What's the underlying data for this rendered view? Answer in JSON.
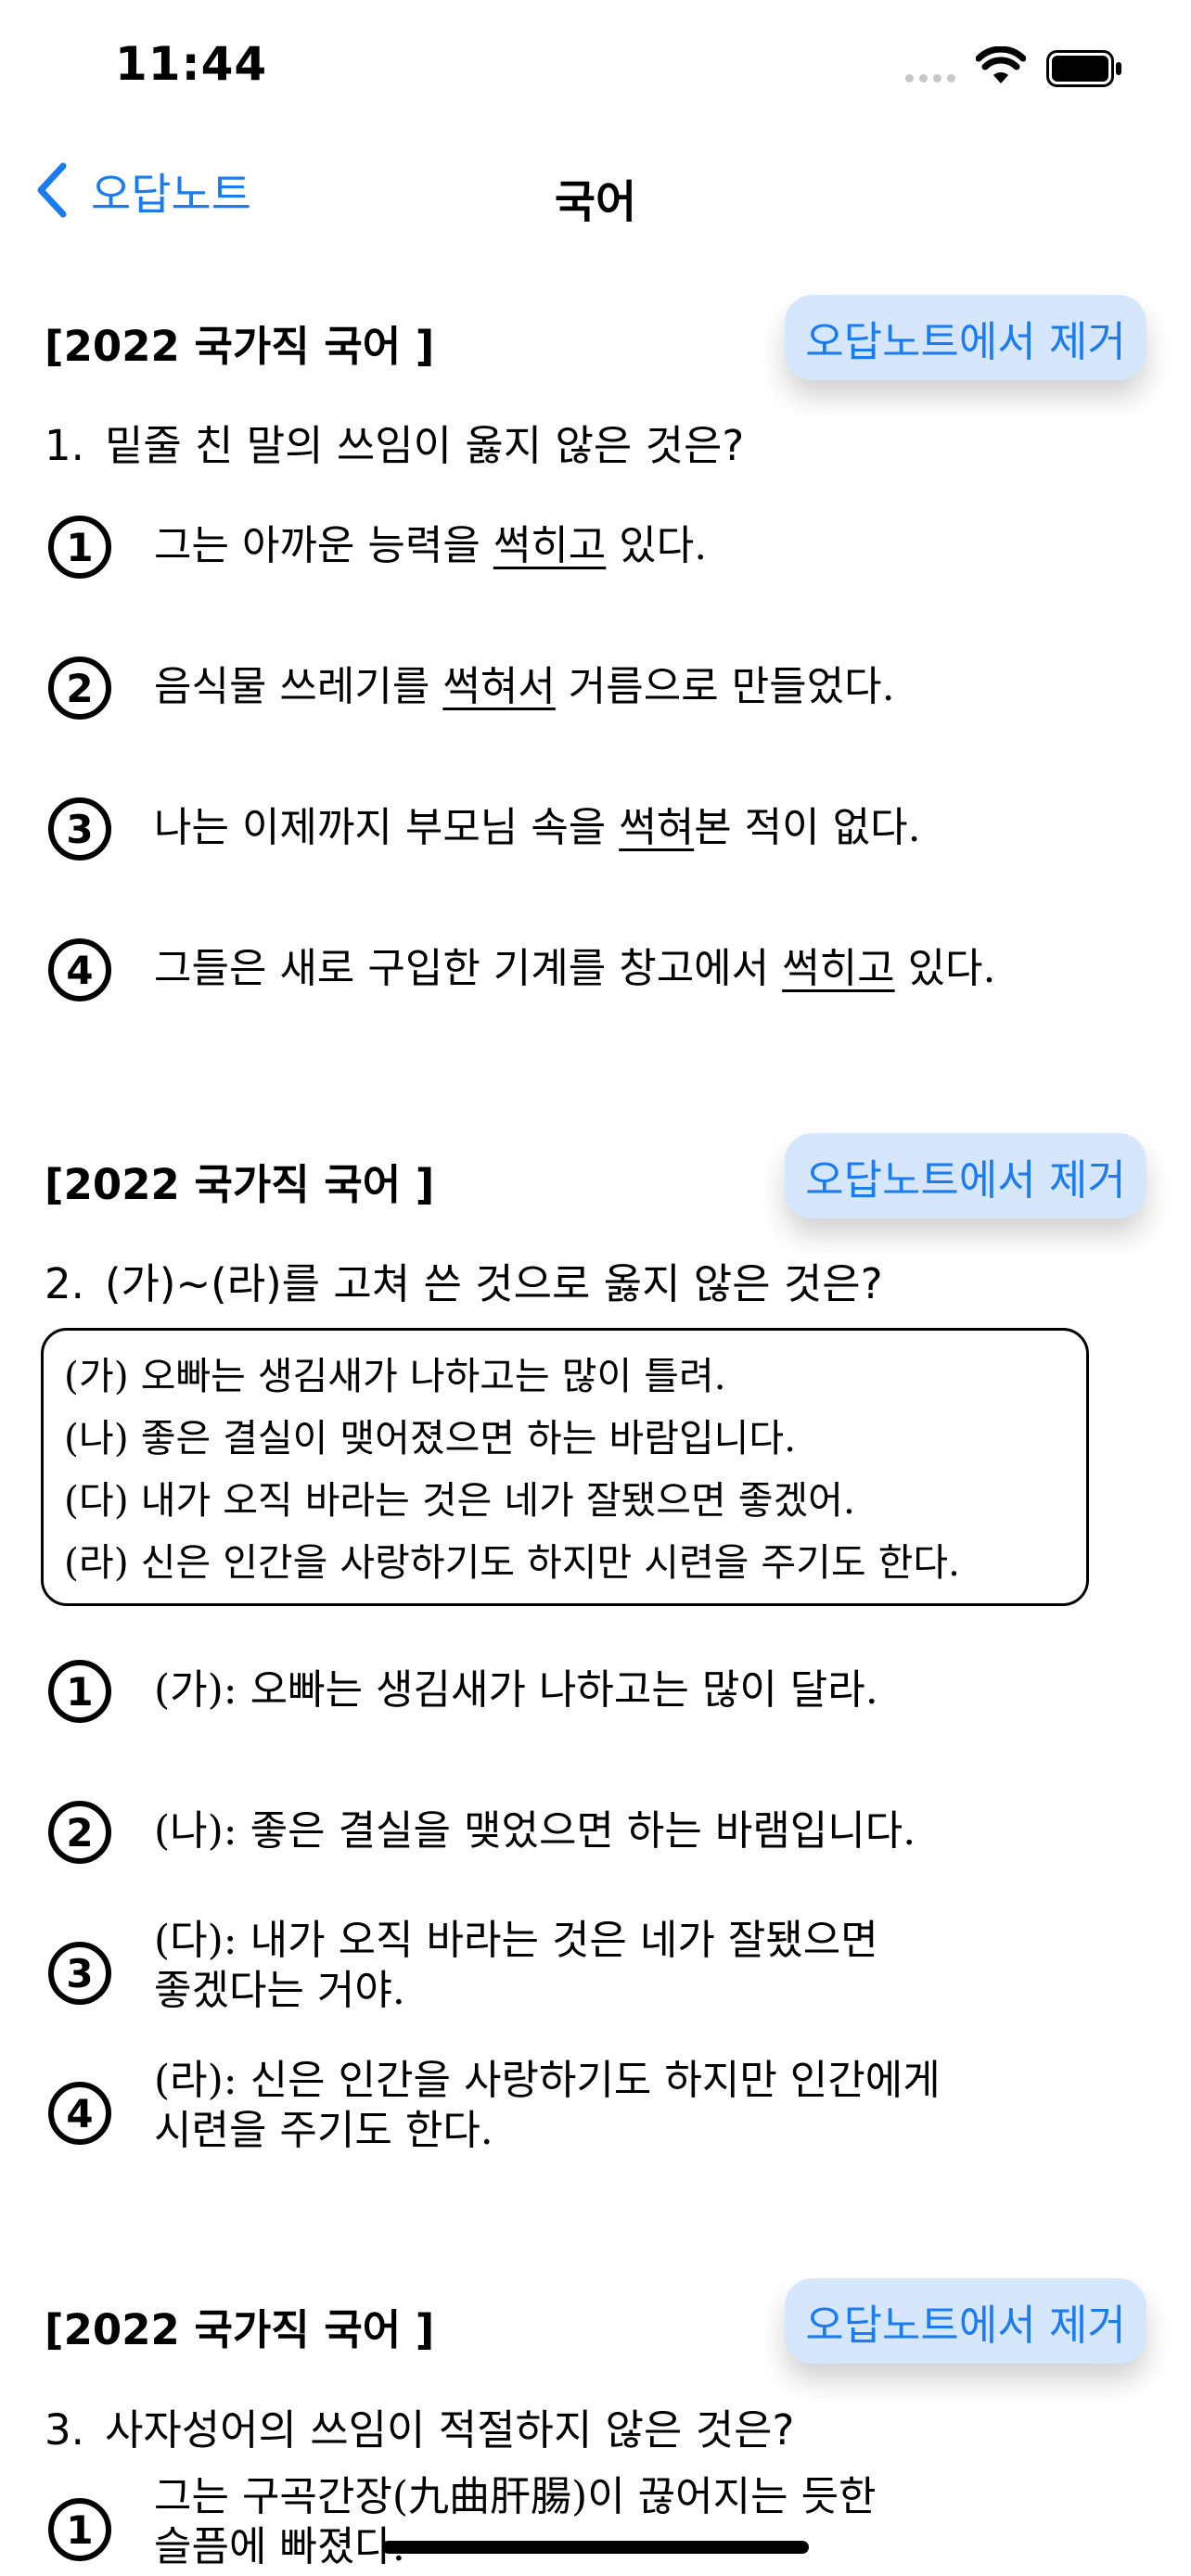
{
  "status_bar": {
    "time": "11:44"
  },
  "nav": {
    "back_label": "오답노트",
    "title": "국어"
  },
  "sections": [
    {
      "tag": "[2022 국가직 국어 ]",
      "remove_label": "오답노트에서 제거",
      "number": "1.",
      "question": "밑줄 친 말의 쓰임이 옳지 않은 것은?",
      "options": [
        {
          "marker": "1",
          "pre": "그는 아까운 능력을 ",
          "u": "썩히고",
          "post": " 있다."
        },
        {
          "marker": "2",
          "pre": "음식물 쓰레기를 ",
          "u": "썩혀서",
          "post": " 거름으로 만들었다."
        },
        {
          "marker": "3",
          "pre": "나는 이제까지 부모님 속을 ",
          "u": "썩혀",
          "post": "본 적이 없다."
        },
        {
          "marker": "4",
          "pre": "그들은 새로 구입한 기계를 창고에서 ",
          "u": "썩히고",
          "post": " 있다."
        }
      ]
    },
    {
      "tag": "[2022 국가직 국어 ]",
      "remove_label": "오답노트에서 제거",
      "number": "2.",
      "question": "(가)~(라)를 고쳐 쓴 것으로 옳지 않은 것은?",
      "passage": [
        "(가) 오빠는 생김새가 나하고는 많이 틀려.",
        "(나) 좋은 결실이 맺어졌으면 하는 바람입니다.",
        "(다) 내가 오직 바라는 것은 네가 잘됐으면 좋겠어.",
        "(라) 신은 인간을 사랑하기도 하지만 시련을 주기도 한다."
      ],
      "options": [
        {
          "marker": "1",
          "line1": "(가): 오빠는 생김새가 나하고는 많이 달라.",
          "line2": ""
        },
        {
          "marker": "2",
          "line1": "(나): 좋은 결실을 맺었으면 하는 바램입니다.",
          "line2": ""
        },
        {
          "marker": "3",
          "line1": "(다): 내가 오직 바라는 것은 네가 잘됐으면",
          "line2": "좋겠다는 거야."
        },
        {
          "marker": "4",
          "line1": "(라): 신은 인간을 사랑하기도 하지만 인간에게",
          "line2": "시련을 주기도 한다."
        }
      ]
    },
    {
      "tag": "[2022 국가직 국어 ]",
      "remove_label": "오답노트에서 제거",
      "number": "3.",
      "question": "사자성어의 쓰임이 적절하지 않은 것은?",
      "options": [
        {
          "marker": "1",
          "line1": "그는 구곡간장(九曲肝腸)이 끊어지는 듯한",
          "line2": "슬픔에 빠졌다."
        }
      ]
    }
  ]
}
